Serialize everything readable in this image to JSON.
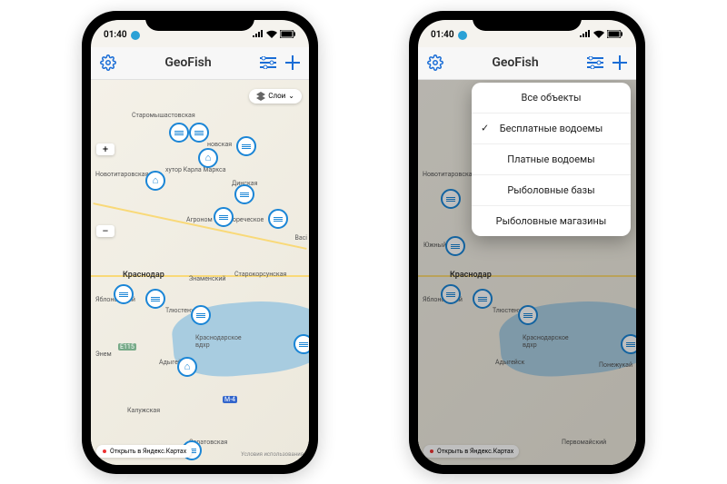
{
  "status": {
    "time": "01:40"
  },
  "header": {
    "title": "GeoFish"
  },
  "layers_button": {
    "label": "Слои",
    "chevron": "⌄"
  },
  "open_yandex_label": "Открыть в Яндекс.Картах",
  "map_attribution": "Условия использования",
  "zoom": {
    "in": "+",
    "out": "–"
  },
  "cities": {
    "staromyshastovskaya": "Старомышастовская",
    "novotitarovskaya": "Новотитаровская",
    "khutor_karla_marxa": "хутор Карла Маркса",
    "dinskaya": "Динская",
    "novskaya": "новская",
    "agronom": "Агроном",
    "vorechenskoye": "вореческое",
    "vasi": "Васі",
    "krasnodar": "Краснодар",
    "znamenskiy": "Знаменский",
    "starokorsunskaya": "Старокорсунская",
    "yablonovskiy": "Яблоновский",
    "tlyustenkhabl": "Тлюстенхабль",
    "krasnodarskoye_vdkh": "Краснодарское\nвдхр",
    "enem": "Энем",
    "adygeysk": "Адыгейск",
    "ponezhukay": "Понежукай",
    "kaluzhskaya": "Калужская",
    "saratovskaya": "Саратовская",
    "yuzhnyy": "Южный",
    "pervomayskiy": "Первомайский",
    "e115": "Е115",
    "m4": "М-4"
  },
  "filter_dropdown": {
    "items": [
      {
        "label": "Все объекты",
        "checked": false
      },
      {
        "label": "Бесплатные водоемы",
        "checked": true
      },
      {
        "label": "Платные водоемы",
        "checked": false
      },
      {
        "label": "Рыболовные базы",
        "checked": false
      },
      {
        "label": "Рыболовные магазины",
        "checked": false
      }
    ]
  }
}
